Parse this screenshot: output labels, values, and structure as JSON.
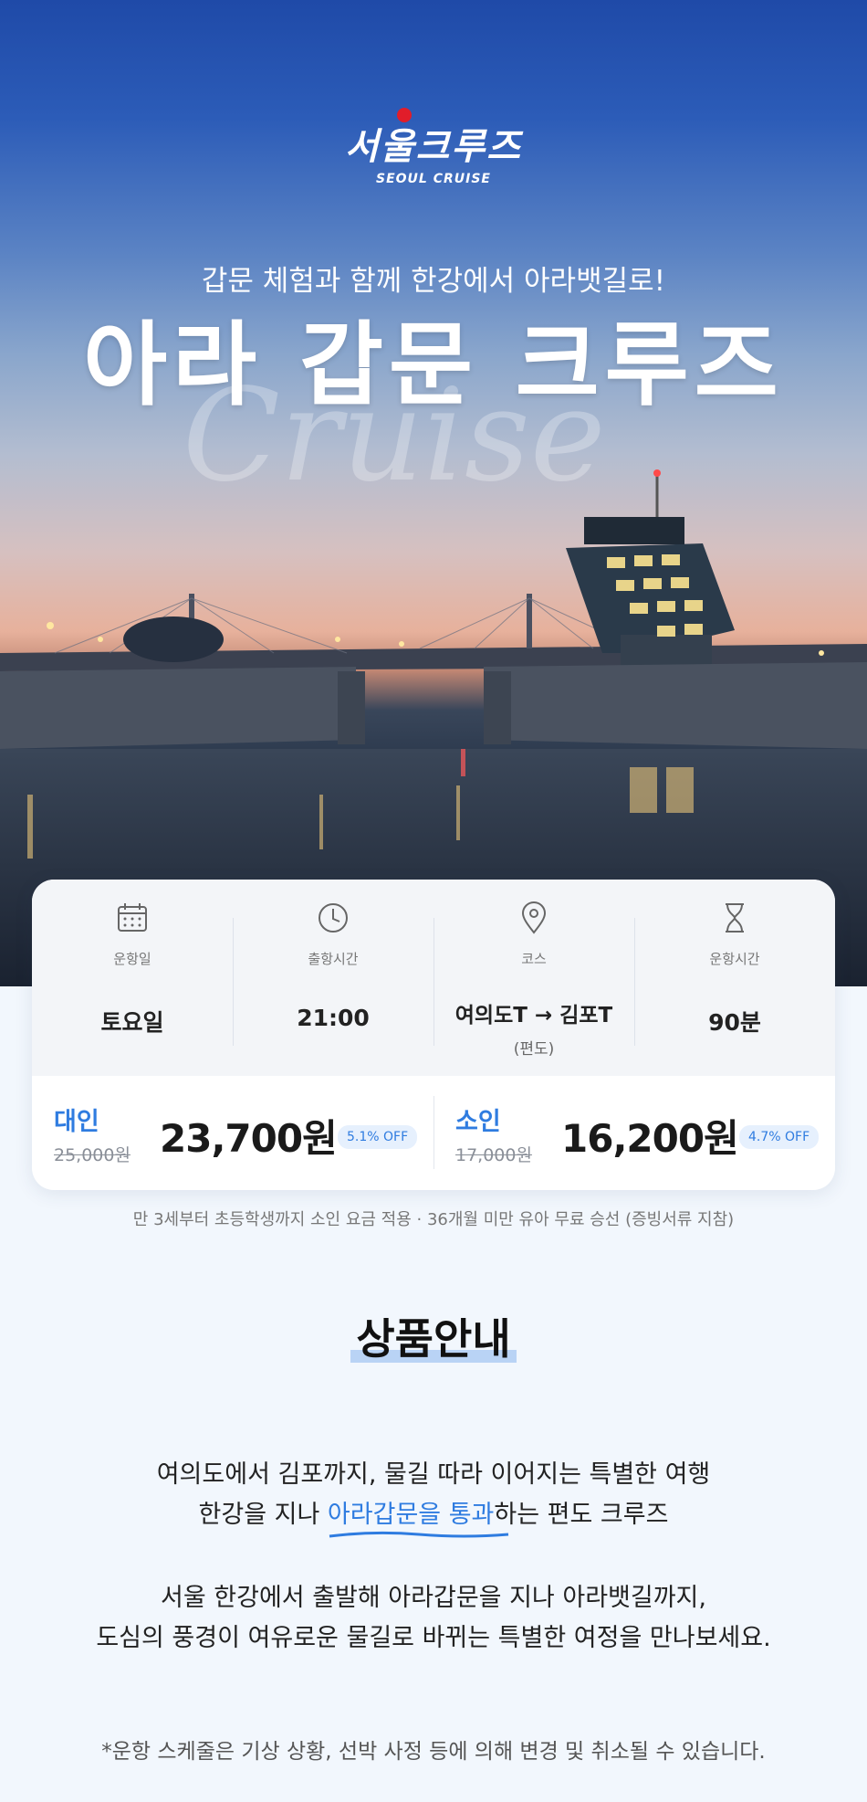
{
  "logo": {
    "main": "서울크루즈",
    "sub": "SEOUL CRUISE"
  },
  "hero": {
    "subtitle": "갑문 체험과 함께 한강에서 아라뱃길로!",
    "title": "아라 갑문 크루즈",
    "script_text": "Cruise"
  },
  "info": {
    "schedule": {
      "icon": "calendar-icon",
      "label": "운항일",
      "value": "토요일"
    },
    "departure": {
      "icon": "clock-icon",
      "label": "출항시간",
      "value": "21:00"
    },
    "course": {
      "icon": "location-pin-icon",
      "label": "코스",
      "value": "여의도T → 김포T",
      "note": "(편도)"
    },
    "duration": {
      "icon": "hourglass-icon",
      "label": "운항시간",
      "value": "90분"
    }
  },
  "prices": {
    "adult": {
      "label": "대인",
      "original": "25,000원",
      "price": "23,700원",
      "badge": "5.1% OFF"
    },
    "child": {
      "label": "소인",
      "original": "17,000원",
      "price": "16,200원",
      "badge": "4.7% OFF"
    }
  },
  "footnote": "만 3세부터 초등학생까지 소인 요금 적용 · 36개월 미만 유아 무료 승선 (증빙서류 지참)",
  "section": {
    "title": "상품안내",
    "line1": "여의도에서 김포까지, 물길 따라 이어지는 특별한 여행",
    "line2_pre": "한강을 지나 ",
    "line2_highlight": "아라갑문을 통과",
    "line2_post": "하는 편도 크루즈",
    "line3": "서울 한강에서 출발해 아라갑문을 지나 아라뱃길까지,",
    "line4": "도심의 풍경이 여유로운 물길로 바뀌는 특별한 여정을 만나보세요."
  },
  "disclaimer": "*운항 스케줄은 기상 상황, 선박 사정 등에 의해 변경 및 취소될 수 있습니다.",
  "colors": {
    "accent": "#2f7ce0",
    "logo_red": "#e11d2a",
    "badge_bg": "#e6f0fd"
  }
}
